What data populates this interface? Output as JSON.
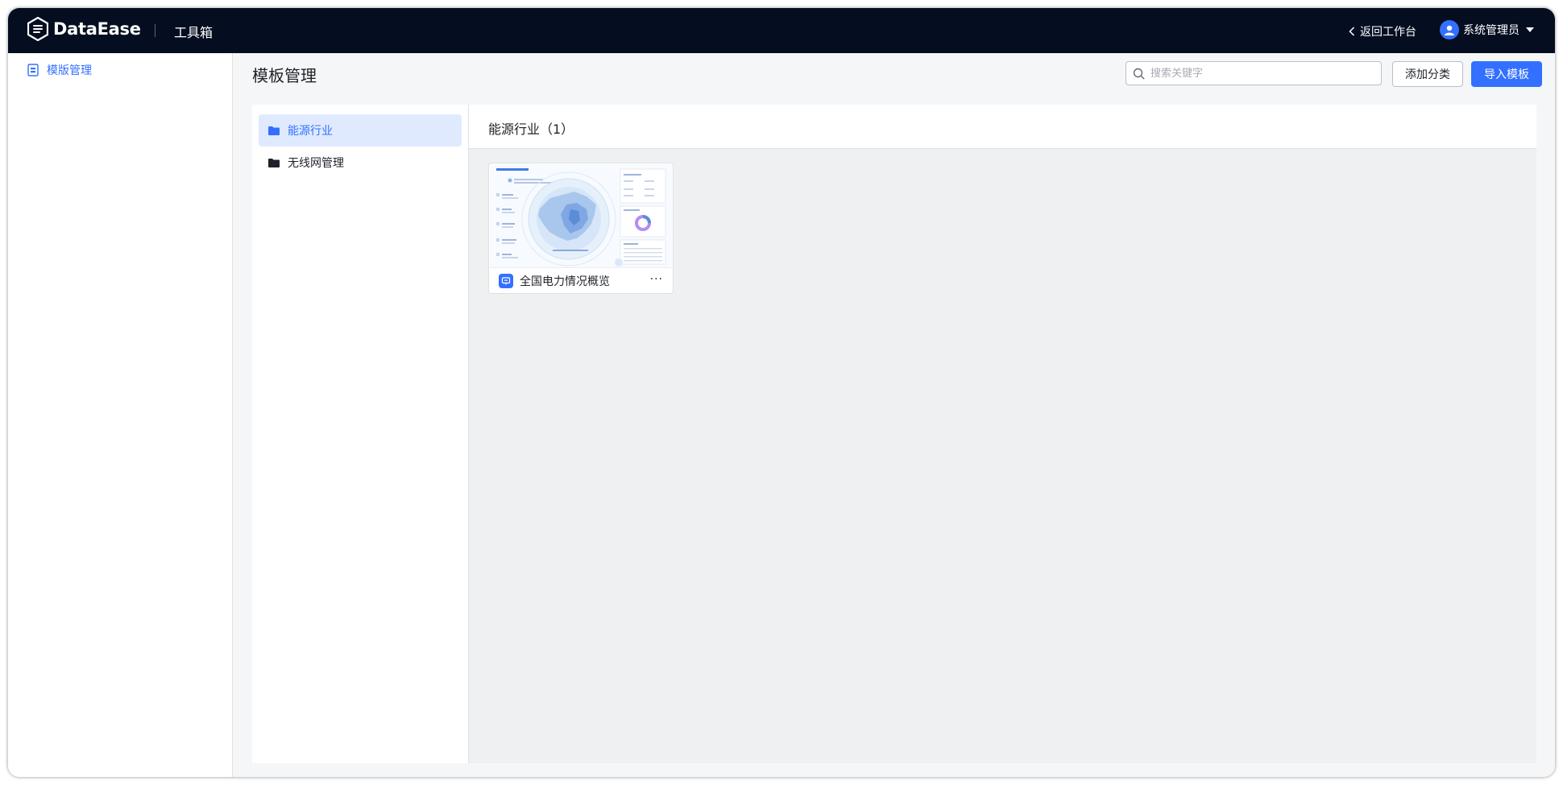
{
  "header": {
    "brand": "DataEase",
    "section": "工具箱",
    "back_label": "返回工作台",
    "user_name": "系统管理员"
  },
  "sidebar": {
    "items": [
      {
        "label": "模版管理",
        "active": true
      }
    ]
  },
  "page": {
    "title": "模板管理",
    "search_placeholder": "搜索关键字",
    "add_category_label": "添加分类",
    "import_label": "导入模板"
  },
  "categories": [
    {
      "label": "能源行业",
      "active": true
    },
    {
      "label": "无线网管理",
      "active": false
    }
  ],
  "list": {
    "title": "能源行业（1）",
    "templates": [
      {
        "name": "全国电力情况概览",
        "more": "···"
      }
    ]
  },
  "colors": {
    "accent": "#3370ff",
    "topbar": "#050e21",
    "active_bg": "#e0eaff"
  },
  "icons": {
    "back": "chevron-left-icon",
    "user": "avatar-icon",
    "sidebar_item": "template-doc-icon",
    "category": "folder-icon",
    "search": "search-icon",
    "card": "screen-icon"
  }
}
